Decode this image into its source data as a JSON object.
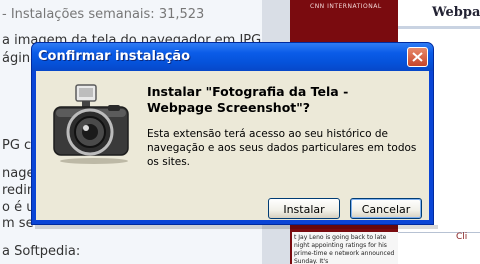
{
  "background": {
    "lines": [
      "- Instalações semanais: 31,523",
      "a imagem da tela do navegador em JPG",
      "ágina",
      "PG c",
      "nagem",
      "redim",
      "o é u",
      "m se",
      "a Softpedia:"
    ],
    "cnn_label": "CNN INTERNATIONAL",
    "cnn_text": "t Jay Leno is going back to late night appointing ratings for his prime-time e network announced Sunday. It's",
    "right_title": "Webpag",
    "right_link": "Cli"
  },
  "dialog": {
    "title": "Confirmar instalação",
    "heading": "Instalar \"Fotografia da Tela  - Webpage Screenshot\"?",
    "description": "Esta extensão terá acesso ao seu histórico de navegação e aos seus dados particulares em todos os sites.",
    "install_label": "Instalar",
    "cancel_label": "Cancelar",
    "icon": "camera-icon",
    "colors": {
      "titlebar": "#0b5ce8",
      "body": "#ece9d8",
      "close": "#c8452a"
    }
  }
}
